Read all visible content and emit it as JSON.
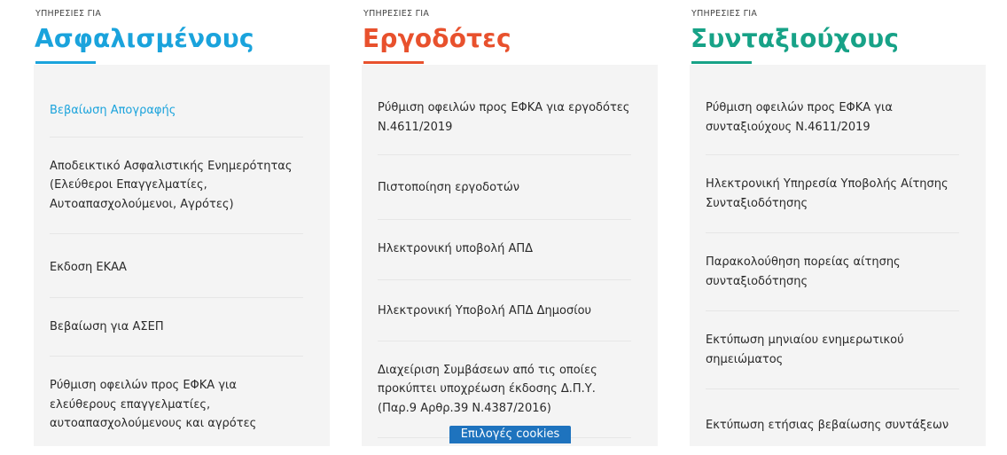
{
  "columns": [
    {
      "eyebrow": "ΥΠΗΡΕΣΙΕΣ ΓΙΑ",
      "title": "Ασφαλισμένους",
      "accent": "#1aa3dc",
      "items": [
        {
          "label": "Βεβαίωση Απογραφής",
          "active": true
        },
        {
          "label": "Αποδεικτικό Ασφαλιστικής Ενημερότητας (Ελεύθεροι Επαγγελματίες, Αυτοαπασχολούμενοι, Αγρότες)"
        },
        {
          "label": "Εκδοση ΕΚΑΑ"
        },
        {
          "label": "Βεβαίωση για ΑΣΕΠ"
        },
        {
          "label": "Ρύθμιση οφειλών προς ΕΦΚΑ για ελεύθερους επαγγελματίες, αυτοαπασχολούμενους και αγρότες"
        }
      ]
    },
    {
      "eyebrow": "ΥΠΗΡΕΣΙΕΣ ΓΙΑ",
      "title": "Εργοδότες",
      "accent": "#e8512d",
      "items": [
        {
          "label": "Ρύθμιση οφειλών προς ΕΦΚΑ για εργοδότες Ν.4611/2019"
        },
        {
          "label": "Πιστοποίηση εργοδοτών"
        },
        {
          "label": "Ηλεκτρονική υποβολή ΑΠΔ"
        },
        {
          "label": "Ηλεκτρονική Υποβολή ΑΠΔ Δημοσίου"
        },
        {
          "label": "Διαχείριση Συμβάσεων από τις οποίες προκύπτει υποχρέωση έκδοσης Δ.Π.Υ. (Παρ.9 Αρθρ.39 Ν.4387/2016)"
        }
      ]
    },
    {
      "eyebrow": "ΥΠΗΡΕΣΙΕΣ ΓΙΑ",
      "title": "Συνταξιούχους",
      "accent": "#17a287",
      "items": [
        {
          "label": "Ρύθμιση οφειλών προς ΕΦΚΑ για συνταξιούχους Ν.4611/2019"
        },
        {
          "label": "Ηλεκτρονική Υπηρεσία Υποβολής Αίτησης Συνταξιοδότησης"
        },
        {
          "label": "Παρακολούθηση πορείας αίτησης συνταξιοδότησης"
        },
        {
          "label": "Εκτύπωση μηνιαίου ενημερωτικού σημειώματος"
        },
        {
          "label": "Εκτύπωση ετήσιας βεβαίωσης συντάξεων"
        }
      ]
    }
  ],
  "cookie_button": {
    "label": "Επιλογές cookies",
    "color": "#1e73be"
  }
}
